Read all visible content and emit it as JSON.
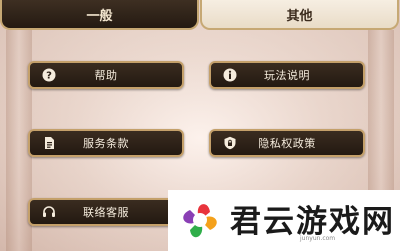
{
  "tabs": [
    {
      "label": "一般",
      "active": false
    },
    {
      "label": "其他",
      "active": true
    }
  ],
  "buttons": {
    "help": {
      "label": "帮助",
      "icon": "question-icon"
    },
    "how_to_play": {
      "label": "玩法说明",
      "icon": "info-icon"
    },
    "terms": {
      "label": "服务条款",
      "icon": "document-icon"
    },
    "privacy": {
      "label": "隐私权政策",
      "icon": "shield-lock-icon"
    },
    "support": {
      "label": "联络客服",
      "icon": "headset-icon"
    }
  },
  "watermark": {
    "brand": "君云游戏网",
    "domain": "junyun.com",
    "icon": "flower-logo-icon"
  },
  "colors": {
    "button_bg": "#2a1f16",
    "button_border": "#c4a06a",
    "button_text": "#f5ecdd",
    "tab_dark": "#2f2419",
    "tab_light": "#f2e9dc"
  }
}
